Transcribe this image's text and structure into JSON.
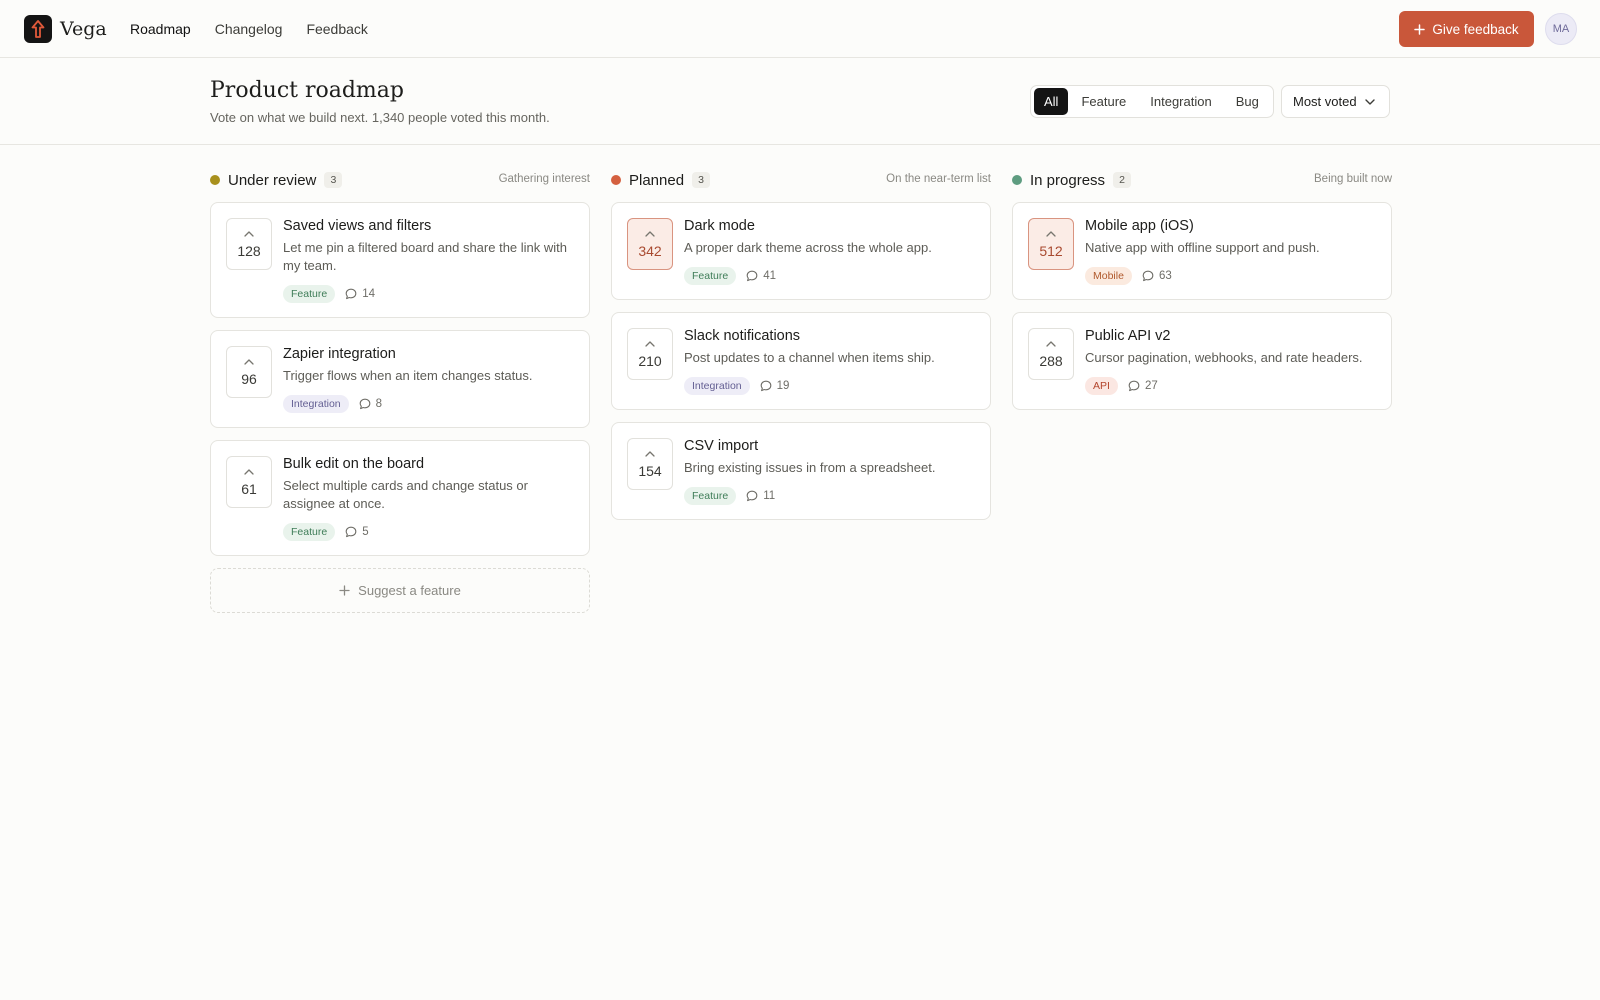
{
  "app": {
    "name": "Vega"
  },
  "nav": [
    {
      "label": "Roadmap",
      "active": true
    },
    {
      "label": "Changelog",
      "active": false
    },
    {
      "label": "Feedback",
      "active": false
    }
  ],
  "actions": {
    "give_feedback": "Give feedback",
    "avatar_initials": "MA"
  },
  "page": {
    "title": "Product roadmap",
    "subtitle": "Vote on what we build next. 1,340 people voted this month."
  },
  "filters": [
    {
      "label": "All",
      "active": true
    },
    {
      "label": "Feature",
      "active": false
    },
    {
      "label": "Integration",
      "active": false
    },
    {
      "label": "Bug",
      "active": false
    }
  ],
  "sort": {
    "label": "Most voted"
  },
  "colors": {
    "accent": "#c9573a",
    "review": "#a8901c",
    "planned": "#d4603f",
    "progress": "#5e9c80"
  },
  "columns": [
    {
      "title": "Under review",
      "count": "3",
      "hint": "Gathering interest",
      "dot": "#a8901c",
      "cards": [
        {
          "votes": "128",
          "title": "Saved views and filters",
          "desc": "Let me pin a filtered board and share the link with my team.",
          "tag": "Feature",
          "tag_style": "feature",
          "comments": "14",
          "hot": false
        },
        {
          "votes": "96",
          "title": "Zapier integration",
          "desc": "Trigger flows when an item changes status.",
          "tag": "Integration",
          "tag_style": "integration",
          "comments": "8",
          "hot": false
        },
        {
          "votes": "61",
          "title": "Bulk edit on the board",
          "desc": "Select multiple cards and change status or assignee at once.",
          "tag": "Feature",
          "tag_style": "feature",
          "comments": "5",
          "hot": false
        }
      ]
    },
    {
      "title": "Planned",
      "count": "3",
      "hint": "On the near-term list",
      "dot": "#d4603f",
      "cards": [
        {
          "votes": "342",
          "title": "Dark mode",
          "desc": "A proper dark theme across the whole app.",
          "tag": "Feature",
          "tag_style": "feature",
          "comments": "41",
          "hot": true
        },
        {
          "votes": "210",
          "title": "Slack notifications",
          "desc": "Post updates to a channel when items ship.",
          "tag": "Integration",
          "tag_style": "integration",
          "comments": "19",
          "hot": false
        },
        {
          "votes": "154",
          "title": "CSV import",
          "desc": "Bring existing issues in from a spreadsheet.",
          "tag": "Feature",
          "tag_style": "feature",
          "comments": "11",
          "hot": false
        }
      ]
    },
    {
      "title": "In progress",
      "count": "2",
      "hint": "Being built now",
      "dot": "#5e9c80",
      "cards": [
        {
          "votes": "512",
          "title": "Mobile app (iOS)",
          "desc": "Native app with offline support and push.",
          "tag": "Mobile",
          "tag_style": "mobile",
          "comments": "63",
          "hot": true
        },
        {
          "votes": "288",
          "title": "Public API v2",
          "desc": "Cursor pagination, webhooks, and rate headers.",
          "tag": "API",
          "tag_style": "api",
          "comments": "27",
          "hot": false
        }
      ]
    }
  ],
  "suggest": {
    "label": "Suggest a feature"
  }
}
